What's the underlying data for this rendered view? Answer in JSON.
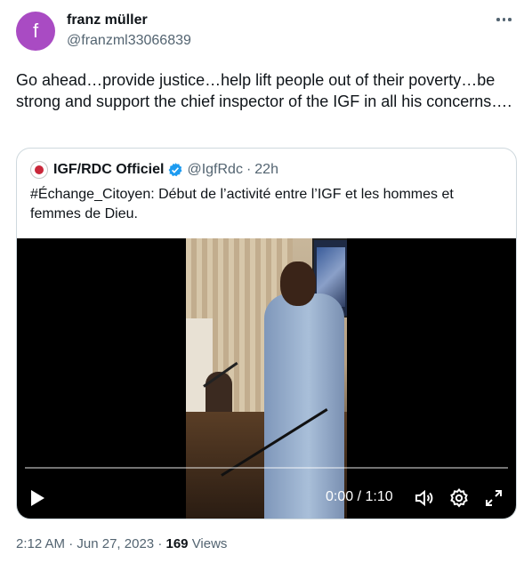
{
  "author": {
    "avatar_letter": "f",
    "name": "franz müller",
    "handle": "@franzml33066839"
  },
  "tweet": {
    "text": "Go ahead…provide justice…help lift people out of their poverty…be strong and support the chief inspector of the IGF in all his concerns…."
  },
  "quoted": {
    "name": "IGF/RDC Officiel",
    "handle": "@IgfRdc",
    "separator": "·",
    "age": "22h",
    "text": "#Échange_Citoyen: Début de l’activité entre l’IGF et les hommes et femmes de Dieu.",
    "video": {
      "time": "0:00 / 1:10",
      "progress": 0
    }
  },
  "footer": {
    "time": "2:12 AM",
    "separator": "·",
    "date": "Jun 27, 2023",
    "dot": "·",
    "views_count": "169",
    "views_label": "Views"
  },
  "colors": {
    "avatar": "#a94bc3",
    "verified": "#1d9bf0",
    "secondary_text": "#536471"
  }
}
